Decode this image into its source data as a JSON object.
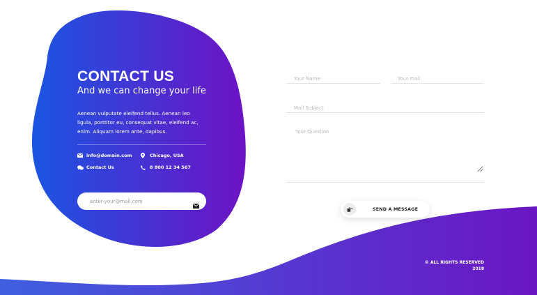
{
  "colors": {
    "gradient_start": "#1b55e2",
    "gradient_end": "#6e12c4",
    "wave_start": "#3f5fe0",
    "wave_end": "#6a16c2"
  },
  "contact": {
    "title": "CONTACT US",
    "subtitle": "And we can change your life",
    "description": "Aenean vulputate eleifend tellus. Aenean leo ligula, porttitor eu, consequat vitae, eleifend ac, enim. Aliquam lorem ante, dapibus.",
    "email": "info@domain.com",
    "location": "Chicago, USA",
    "contact_link": "Contact Us",
    "phone": "8 800 12 34 567"
  },
  "subscribe": {
    "placeholder": "enter-your@mail.com"
  },
  "form": {
    "name_placeholder": "Your Name",
    "mail_placeholder": "Your mail",
    "subject_placeholder": "Mail Subject",
    "question_placeholder": "Your Question",
    "send_label": "SEND A MESSAGE"
  },
  "footer": {
    "line1": "© ALL RIGHTS RESERVED",
    "line2": "2018"
  },
  "icons": {
    "email": "envelope-icon",
    "location": "map-pin-icon",
    "contact": "chat-bubbles-icon",
    "phone": "phone-icon",
    "subscribe_send": "envelope-icon",
    "send_message": "pointing-hand-icon"
  }
}
